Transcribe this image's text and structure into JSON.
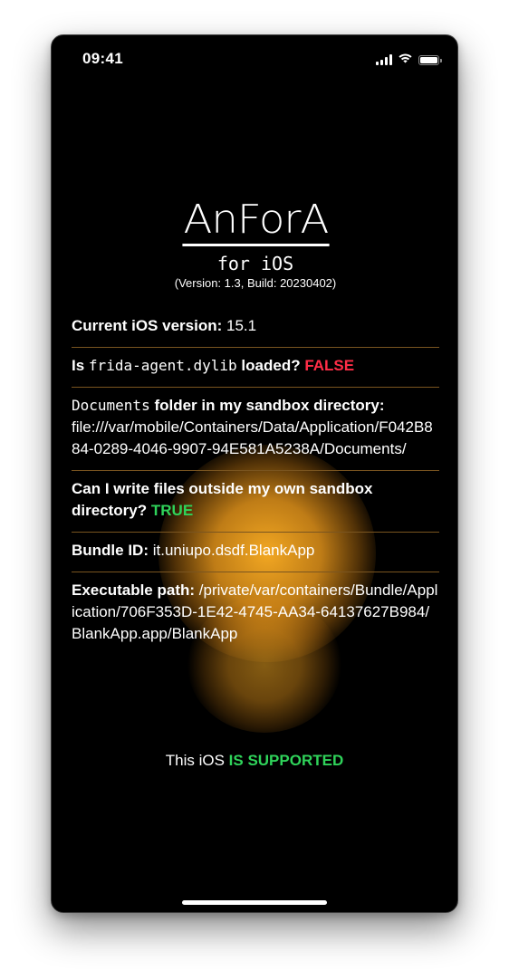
{
  "status_bar": {
    "time": "09:41",
    "icons": [
      "cellular-signal-icon",
      "wifi-icon",
      "battery-icon"
    ]
  },
  "app": {
    "logo": "AnForA",
    "subtitle": "for iOS",
    "version": "(Version: 1.3, Build: 20230402)"
  },
  "info": {
    "ios_version_label": "Current iOS version:",
    "ios_version_value": "15.1",
    "frida_prefix": "Is",
    "frida_lib": "frida-agent.dylib",
    "frida_suffix": "loaded?",
    "frida_value": "FALSE",
    "documents_word": "Documents",
    "documents_label_rest": "folder in my sandbox directory:",
    "documents_path": "file:///var/mobile/Containers/Data/Application/F042B884-0289-4046-9907-94E581A5238A/Documents/",
    "write_label": "Can I write files outside my own sandbox directory?",
    "write_value": "TRUE",
    "bundle_label": "Bundle ID:",
    "bundle_value": "it.uniupo.dsdf.BlankApp",
    "exec_label": "Executable path:",
    "exec_value": "/private/var/containers/Bundle/Application/706F353D-1E42-4745-AA34-64137627B984/BlankApp.app/BlankApp"
  },
  "support": {
    "prefix": "This iOS",
    "status": "IS SUPPORTED"
  },
  "colors": {
    "background": "#000000",
    "false_red": "#ff2d47",
    "true_green": "#2fd35a",
    "divider": "#7a5520",
    "glow": "#ffb024"
  }
}
